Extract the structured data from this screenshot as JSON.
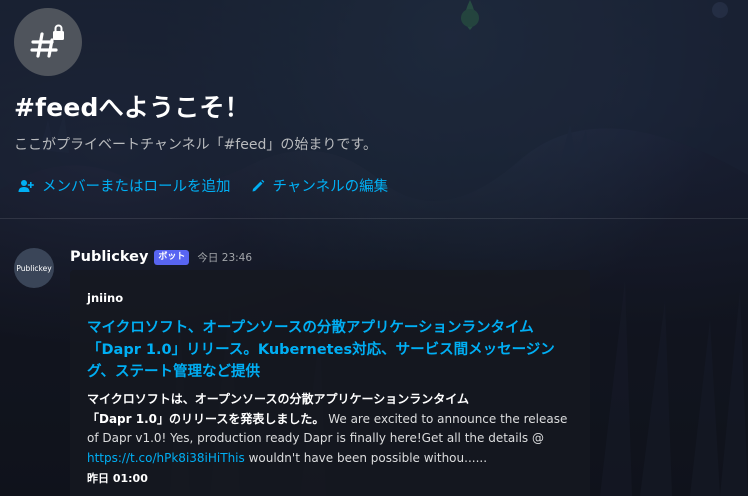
{
  "channel": {
    "icon": "hash-lock-icon",
    "welcome_title": "#feedへようこそ！",
    "welcome_subtitle": "ここがプライベートチャンネル「#feed」の始まりです。",
    "actions": [
      {
        "label": "メンバーまたはロールを追加",
        "icon": "add-member-icon"
      },
      {
        "label": "チャンネルの編集",
        "icon": "pencil-icon"
      }
    ]
  },
  "message": {
    "avatar_text": "Publickey",
    "author": "Publickey",
    "bot_tag": "ボット",
    "timestamp": "今日 23:46",
    "embed": {
      "author": "jniino",
      "title": "マイクロソフト、オープンソースの分散アプリケーションランタイム「Dapr 1.0」リリース。Kubernetes対応、サービス間メッセージング、ステート管理など提供",
      "description_bold_1": "マイクロソフトは、オープンソースの分散アプリケーションランタイム",
      "description_bold_2": "「Dapr 1.0」のリリースを発表しました。",
      "description_text": " We are excited to announce the release of Dapr v1.0! Yes, production ready Dapr is finally here!Get all the details @ ",
      "description_link": "https://t.co/hPk8i38iHiThis",
      "description_tail": " wouldn't have been possible withou......",
      "footer": "昨日 01:00"
    }
  },
  "colors": {
    "link": "#00aff4",
    "bot_tag_bg": "#5865f2",
    "icon_circle": "#4f545c"
  }
}
